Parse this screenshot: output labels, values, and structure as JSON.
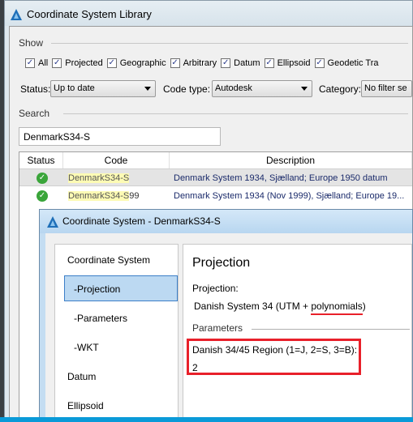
{
  "library_window": {
    "title": "Coordinate System Library"
  },
  "show": {
    "label": "Show",
    "checkboxes": [
      {
        "label": "All",
        "checked": true
      },
      {
        "label": "Projected",
        "checked": true
      },
      {
        "label": "Geographic",
        "checked": true
      },
      {
        "label": "Arbitrary",
        "checked": true
      },
      {
        "label": "Datum",
        "checked": true
      },
      {
        "label": "Ellipsoid",
        "checked": true
      },
      {
        "label": "Geodetic Tra",
        "checked": true
      }
    ]
  },
  "filters": {
    "status_label": "Status:",
    "status_value": "Up to date",
    "code_type_label": "Code type:",
    "code_type_value": "Autodesk",
    "category_label": "Category:",
    "category_value": "No filter se"
  },
  "search": {
    "label": "Search",
    "value": "DenmarkS34-S"
  },
  "table": {
    "columns": [
      "Status",
      "Code",
      "Description"
    ],
    "rows": [
      {
        "status": "up-to-date",
        "code": "DenmarkS34-S",
        "match": "DenmarkS34-S",
        "rest": "",
        "description": "Denmark System 1934, Sjælland; Europe 1950 datum"
      },
      {
        "status": "up-to-date",
        "code": "DenmarkS34-S99",
        "match": "DenmarkS34-S",
        "rest": "99",
        "description": "Denmark System 1934 (Nov 1999), Sjælland; Europe 19..."
      }
    ]
  },
  "dialog": {
    "title": "Coordinate System - DenmarkS34-S",
    "nav": [
      "Coordinate System",
      "-Projection",
      "-Parameters",
      "-WKT",
      "Datum",
      "Ellipsoid"
    ],
    "active_nav": "-Projection",
    "heading": "Projection",
    "projection_label": "Projection:",
    "projection_value_prefix": "Danish System 34 (UTM + ",
    "projection_value_highlight": "polynomials",
    "projection_value_suffix": ")",
    "parameters_label": "Parameters",
    "region_label": "Danish 34/45 Region (1=J, 2=S, 3=B):",
    "region_value": "2"
  },
  "colors": {
    "annotation": "#e8202a",
    "selection": "#bcd9f2",
    "match_highlight": "#fdfbb4",
    "status_ok": "#3aa53a",
    "taskbar": "#0a9ad8"
  }
}
